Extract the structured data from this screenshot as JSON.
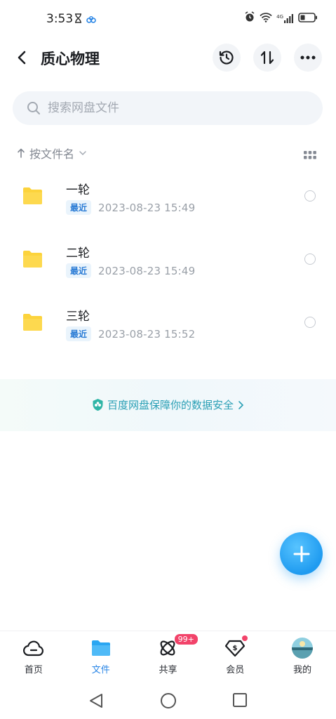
{
  "status_bar": {
    "time": "3:53",
    "network": "4G"
  },
  "header": {
    "title": "质心物理"
  },
  "search": {
    "placeholder": "搜索网盘文件"
  },
  "sort": {
    "label": "按文件名"
  },
  "files": [
    {
      "name": "一轮",
      "badge": "最近",
      "date": "2023-08-23  15:49"
    },
    {
      "name": "二轮",
      "badge": "最近",
      "date": "2023-08-23  15:49"
    },
    {
      "name": "三轮",
      "badge": "最近",
      "date": "2023-08-23  15:52"
    }
  ],
  "banner": {
    "text": "百度网盘保障你的数据安全"
  },
  "nav": {
    "items": [
      {
        "label": "首页",
        "icon": "cloud-home-icon"
      },
      {
        "label": "文件",
        "icon": "folder-icon",
        "active": true
      },
      {
        "label": "共享",
        "icon": "share-atom-icon",
        "badge": "99+"
      },
      {
        "label": "会员",
        "icon": "vip-diamond-icon"
      },
      {
        "label": "我的",
        "icon": "avatar-icon"
      }
    ]
  },
  "colors": {
    "accent": "#2a86e6",
    "folder": "#fcd33c",
    "fab": "#1f9bf0",
    "badge": "#f2436a"
  }
}
